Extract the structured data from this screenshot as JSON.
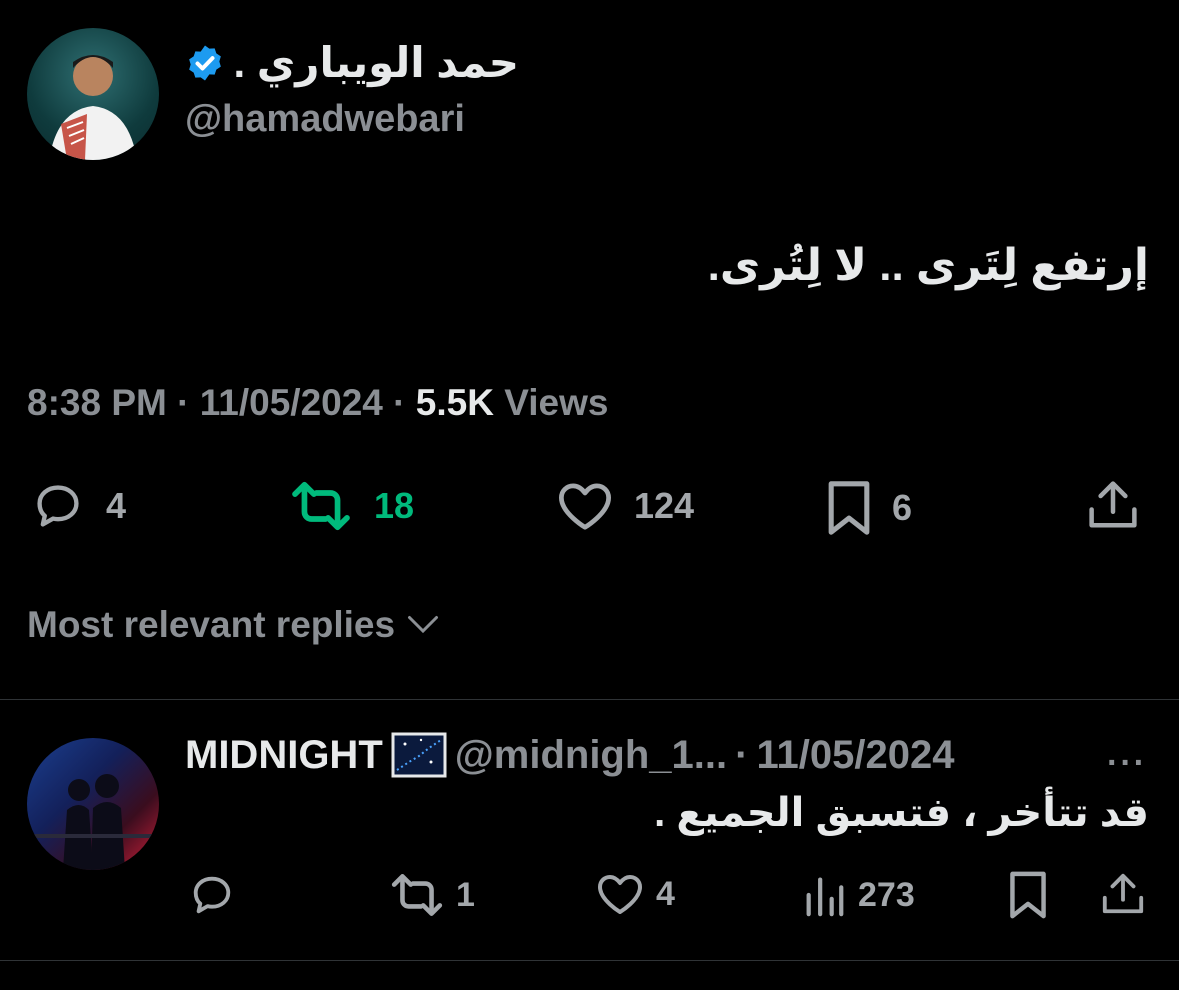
{
  "main_tweet": {
    "display_name": "حمد الويباري .",
    "handle": "@hamadwebari",
    "text": "إرتفع لِتَرى .. لا لِتُرى.",
    "time": "8:38 PM",
    "date": "11/05/2024",
    "views_count": "5.5K",
    "views_label": "Views",
    "separator": "·",
    "actions": {
      "replies": "4",
      "reposts": "18",
      "likes": "124",
      "bookmarks": "6"
    },
    "repost_color": "#00ba7c"
  },
  "replies_section": {
    "sort_label": "Most relevant replies"
  },
  "reply": {
    "display_name": "MIDNIGHT",
    "handle": "@midnigh_1...",
    "separator": "·",
    "date": "11/05/2024",
    "text": "قد تتأخر ، فتسبق الجميع .",
    "actions": {
      "reposts": "1",
      "likes": "4",
      "views": "273"
    }
  },
  "colors": {
    "background": "#000000",
    "primary_text": "#e7e9ea",
    "secondary_text": "#8b8f94",
    "verified_blue": "#1d9bf0"
  }
}
